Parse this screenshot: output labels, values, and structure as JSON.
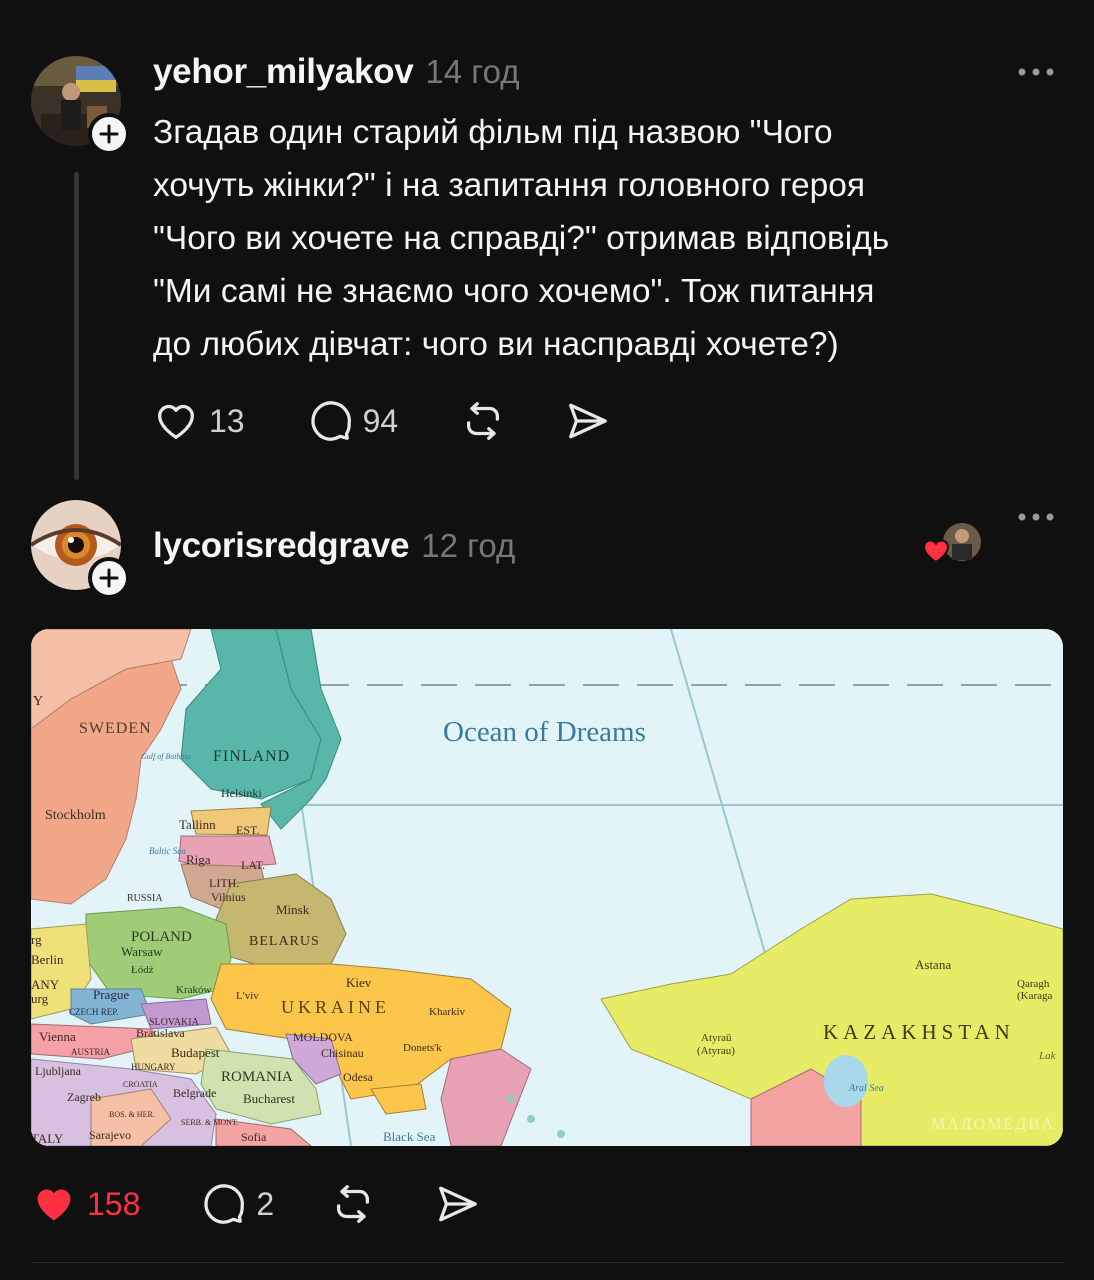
{
  "post1": {
    "username": "yehor_milyakov",
    "time": "14 год",
    "text": "Згадав один старий фільм під назвою \"Чого\nхочуть жінки?\" і на запитання головного героя\n\"Чого ви хочете на справді?\" отримав відповідь\n\"Ми самі не знаємо чого хочемо\". Тож питання\nдо любих дівчат: чого ви насправді хочете?)",
    "likes": "13",
    "replies": "94"
  },
  "post2": {
    "username": "lycorisredgrave",
    "time": "12 год",
    "likes": "158",
    "replies": "2",
    "liked": true,
    "map": {
      "ocean": "Ocean of Dreams",
      "countries": [
        "SWEDEN",
        "FINLAND",
        "EST.",
        "LAT.",
        "LITH.",
        "RUSSIA",
        "BELARUS",
        "POLAND",
        "UKRAINE",
        "MOLDOVA",
        "ROMANIA",
        "HUNGARY",
        "SLOVAKIA",
        "CZECH REP.",
        "AUSTRIA",
        "SERB. & MONT.",
        "BOS. & HER.",
        "CROATIA",
        "KAZAKHSTAN",
        "ANY"
      ],
      "cities": [
        "Stockholm",
        "Helsinki",
        "Tallinn",
        "Riga",
        "Vilnius",
        "Minsk",
        "Warsaw",
        "Łódź",
        "Kraków",
        "L'viv",
        "Kiev",
        "Kharkiv",
        "Donets'k",
        "Prague",
        "Vienna",
        "Bratislava",
        "Budapest",
        "Chisinau",
        "Odesa",
        "Bucharest",
        "Belgrade",
        "Sarajevo",
        "Zagreb",
        "Ljubljana",
        "Berlin",
        "Sofia",
        "Astana",
        "Qaragh",
        "(Karaga",
        "Atyraū",
        "(Atyrau)"
      ],
      "waters": [
        "Gulf of Bothnia",
        "Baltic Sea",
        "Black Sea",
        "Aral Sea"
      ],
      "edge_text": [
        "Y",
        "rg",
        "urg",
        "TALY",
        "Lak"
      ],
      "watermark": "МАЛОМЕДИА"
    },
    "colors": {
      "like_red": "#ff3040"
    }
  }
}
